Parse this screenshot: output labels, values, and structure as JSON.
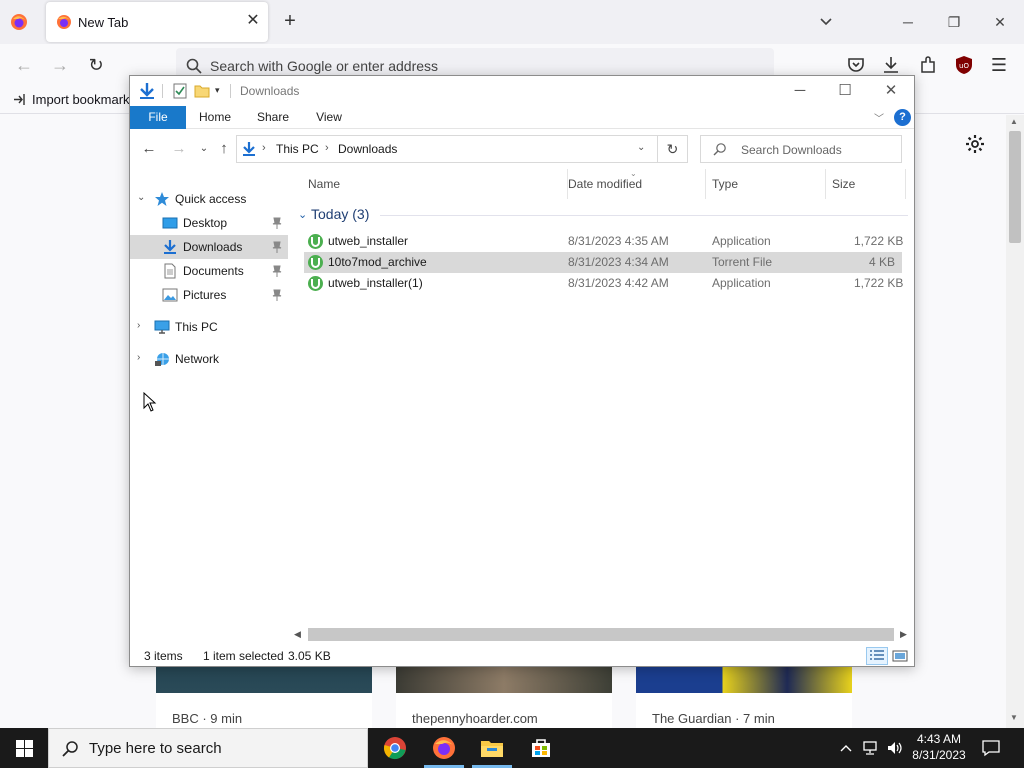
{
  "firefox": {
    "tab_title": "New Tab",
    "url_placeholder": "Search with Google or enter address",
    "bookmark_import": "Import bookmarks",
    "cards": [
      {
        "source": "BBC · 9 min"
      },
      {
        "source": "thepennyhoarder.com"
      },
      {
        "source": "The Guardian · 7 min"
      }
    ]
  },
  "explorer": {
    "title": "Downloads",
    "ribbon_tabs": [
      "File",
      "Home",
      "Share",
      "View"
    ],
    "breadcrumb": [
      "This PC",
      "Downloads"
    ],
    "search_placeholder": "Search Downloads",
    "nav": {
      "quick_access": "Quick access",
      "desktop": "Desktop",
      "downloads": "Downloads",
      "documents": "Documents",
      "pictures": "Pictures",
      "this_pc": "This PC",
      "network": "Network"
    },
    "columns": [
      "Name",
      "Date modified",
      "Type",
      "Size"
    ],
    "group_label": "Today (3)",
    "files": [
      {
        "name": "utweb_installer",
        "date": "8/31/2023 4:35 AM",
        "type": "Application",
        "size": "1,722 KB"
      },
      {
        "name": "10to7mod_archive",
        "date": "8/31/2023 4:34 AM",
        "type": "Torrent File",
        "size": "4 KB"
      },
      {
        "name": "utweb_installer(1)",
        "date": "8/31/2023 4:42 AM",
        "type": "Application",
        "size": "1,722 KB"
      }
    ],
    "status": {
      "items": "3 items",
      "selected": "1 item selected",
      "size": "3.05 KB"
    }
  },
  "taskbar": {
    "search_placeholder": "Type here to search",
    "time": "4:43 AM",
    "date": "8/31/2023"
  },
  "colors": {
    "file_tab": "#1979ca",
    "selection": "#d9d9d9",
    "utorrent_green": "#4caf50"
  }
}
